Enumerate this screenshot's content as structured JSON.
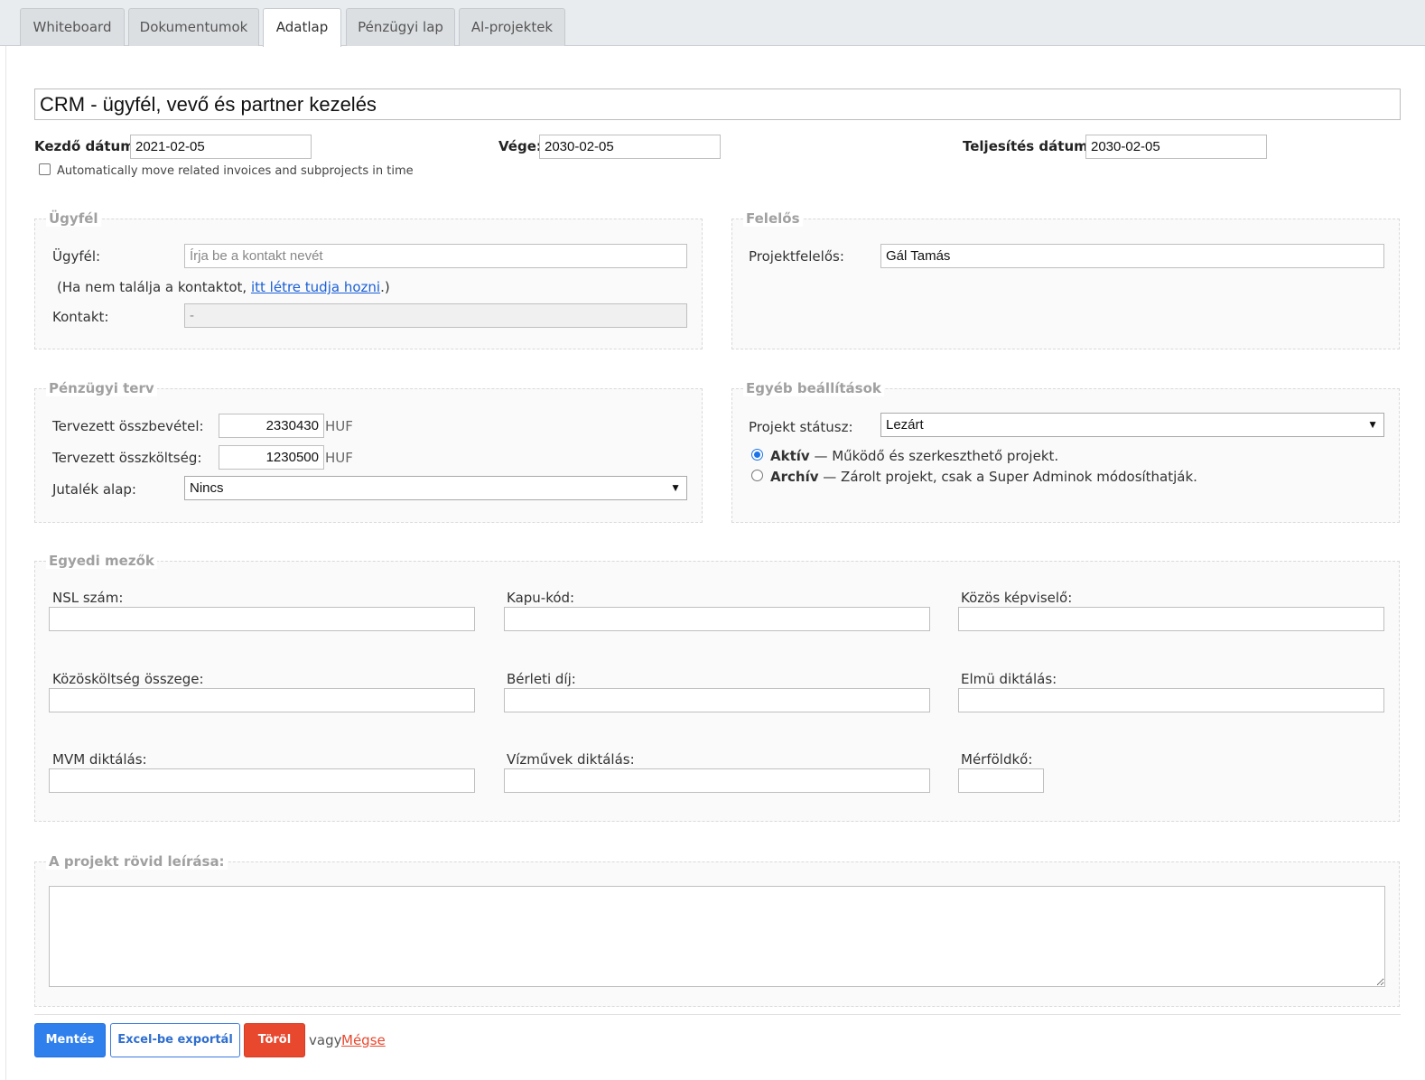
{
  "tabs": [
    "Whiteboard",
    "Dokumentumok",
    "Adatlap",
    "Pénzügyi lap",
    "Al-projektek"
  ],
  "active_tab": "Adatlap",
  "project_title": "CRM - ügyfél, vevő és partner kezelés",
  "dates": {
    "start_label": "Kezdő dátum:",
    "start_value": "2021-02-05",
    "end_label": "Vége:",
    "end_value": "2030-02-05",
    "completion_label": "Teljesítés dátuma:",
    "completion_value": "2030-02-05",
    "auto_move_label": "Automatically move related invoices and subprojects in time"
  },
  "client": {
    "legend": "Ügyfél",
    "client_label": "Ügyfél:",
    "client_placeholder": "Írja be a kontakt nevét",
    "hint_prefix": "(Ha nem találja a kontaktot, ",
    "hint_link": "itt létre tudja hozni",
    "hint_suffix": ".)",
    "contact_label": "Kontakt:",
    "contact_value": "-"
  },
  "responsible": {
    "legend": "Felelős",
    "label": "Projektfelelős:",
    "value": "Gál Tamás"
  },
  "finance": {
    "legend": "Pénzügyi terv",
    "income_label": "Tervezett összbevétel:",
    "income_value": "2330430",
    "cost_label": "Tervezett összköltség:",
    "cost_value": "1230500",
    "currency": "HUF",
    "commission_label": "Jutalék alap:",
    "commission_value": "Nincs"
  },
  "other": {
    "legend": "Egyéb beállítások",
    "status_label": "Projekt státusz:",
    "status_value": "Lezárt",
    "active_title": "Aktív",
    "active_desc": "— Működő és szerkeszthető projekt.",
    "archive_title": "Archív",
    "archive_desc": "— Zárolt projekt, csak a Super Adminok módosíthatják.",
    "selected_state": "Aktív"
  },
  "custom": {
    "legend": "Egyedi mezők",
    "fields": [
      {
        "label": "NSL szám:",
        "value": ""
      },
      {
        "label": "Kapu-kód:",
        "value": ""
      },
      {
        "label": "Közös képviselő:",
        "value": ""
      },
      {
        "label": "Közösköltség összege:",
        "value": ""
      },
      {
        "label": "Bérleti díj:",
        "value": ""
      },
      {
        "label": "Elmü diktálás:",
        "value": ""
      },
      {
        "label": "MVM diktálás:",
        "value": ""
      },
      {
        "label": "Vízművek diktálás:",
        "value": ""
      },
      {
        "label": "Mérföldkő:",
        "value": ""
      }
    ]
  },
  "description": {
    "legend": "A projekt rövid leírása:",
    "value": ""
  },
  "actions": {
    "save": "Mentés",
    "export": "Excel-be exportál",
    "delete": "Töröl",
    "or": "vagy",
    "cancel": "Mégse"
  }
}
